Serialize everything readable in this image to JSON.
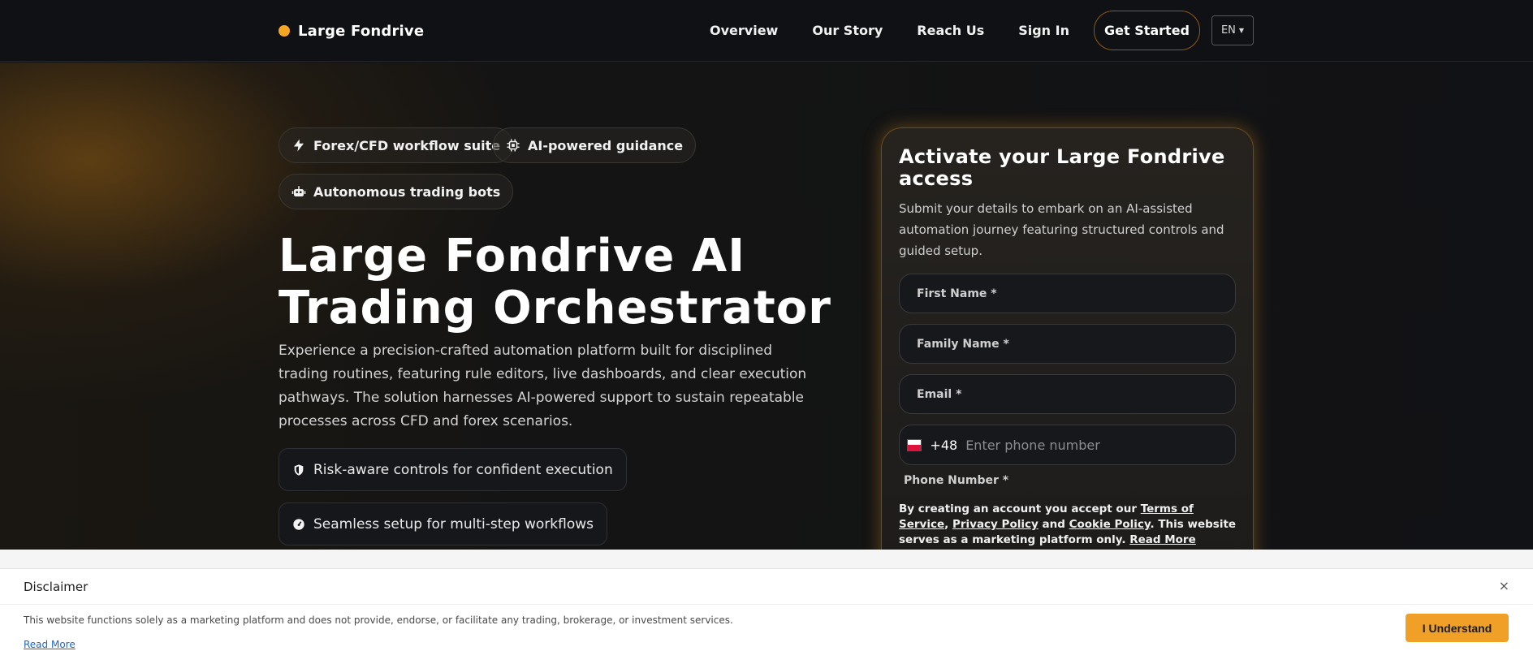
{
  "header": {
    "brand": "Large Fondrive",
    "nav": [
      "Overview",
      "Our Story",
      "Reach Us",
      "Sign In"
    ],
    "cta": "Get Started",
    "language": "EN"
  },
  "hero": {
    "badges": [
      "Forex/CFD workflow suite",
      "AI-powered guidance",
      "Autonomous trading bots"
    ],
    "title_line1": "Large Fondrive AI",
    "title_line2": "Trading Orchestrator",
    "lead": "Experience a precision-crafted automation platform built for disciplined trading routines, featuring rule editors, live dashboards, and clear execution pathways. The solution harnesses AI-powered support to sustain repeatable processes across CFD and forex scenarios.",
    "features": [
      "Risk-aware controls for confident execution",
      "Seamless setup for multi-step workflows"
    ]
  },
  "form": {
    "title": "Activate your Large Fondrive access",
    "subtitle": "Submit your details to embark on an AI-assisted automation journey featuring structured controls and guided setup.",
    "first_name": "First Name *",
    "family_name": "Family Name *",
    "email": "Email *",
    "dial_code": "+48",
    "phone_placeholder": "Enter phone number",
    "phone_label": "Phone Number *",
    "consent_prefix": "By creating an account you accept our ",
    "terms": "Terms of Service",
    "comma": ",",
    "privacy": "Privacy Policy",
    "and": " and ",
    "cookie": "Cookie Policy",
    "consent_suffix": ". This website serves as a marketing platform only. ",
    "read_more": "Read More"
  },
  "disclaimer": {
    "title": "Disclaimer",
    "close": "×",
    "text": "This website functions solely as a marketing platform and does not provide, endorse, or facilitate any trading, brokerage, or investment services.",
    "read_more": "Read More",
    "button": "I Understand"
  },
  "icons": {
    "badge_1": "lightning-icon",
    "badge_2": "chip-icon",
    "badge_3": "robot-icon",
    "feature_1": "shield-icon",
    "feature_2": "gauge-icon"
  },
  "colors": {
    "accent": "#f5a623",
    "background": "#111215",
    "button": "#f0a026"
  }
}
